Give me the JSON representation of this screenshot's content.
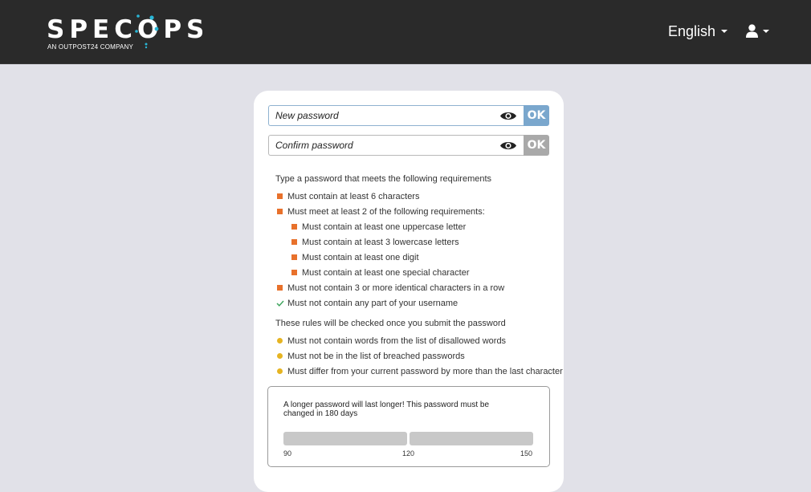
{
  "brand": {
    "name": "SPECOPS",
    "tagline": "AN OUTPOST24 COMPANY",
    "accent": "#29b6d6"
  },
  "header": {
    "language": "English",
    "user_icon": "user-icon"
  },
  "form": {
    "new_password": {
      "placeholder": "New password",
      "value": "",
      "ok_label": "OK"
    },
    "confirm_password": {
      "placeholder": "Confirm password",
      "value": "",
      "ok_label": "OK"
    },
    "eye_icon": "eye-icon"
  },
  "requirements": {
    "intro": "Type a password that meets the following requirements",
    "items": [
      {
        "text": "Must contain at least 6 characters",
        "status": "unmet"
      },
      {
        "text": "Must meet at least 2 of the following requirements:",
        "status": "unmet"
      },
      {
        "text": "Must contain at least one uppercase letter",
        "status": "unmet"
      },
      {
        "text": "Must contain at least 3 lowercase letters",
        "status": "unmet"
      },
      {
        "text": "Must contain at least one digit",
        "status": "unmet"
      },
      {
        "text": "Must contain at least one special character",
        "status": "unmet"
      },
      {
        "text": "Must not contain 3 or more identical characters in a row",
        "status": "unmet"
      },
      {
        "text": "Must not contain any part of your username",
        "status": "met"
      }
    ],
    "submit_intro": "These rules will be checked once you submit the password",
    "submit_items": [
      {
        "text": "Must not contain words from the list of disallowed words",
        "status": "pending"
      },
      {
        "text": "Must not be in the list of breached passwords",
        "status": "pending"
      },
      {
        "text": "Must differ from your current password by more than the last character",
        "status": "pending"
      }
    ],
    "colors": {
      "unmet": "#e8712b",
      "met": "#3aa35a",
      "pending": "#e6b422"
    }
  },
  "lifetime": {
    "message": "A longer password will last longer! This password must be changed in 180 days",
    "scale_labels": [
      "90",
      "120",
      "150"
    ]
  }
}
